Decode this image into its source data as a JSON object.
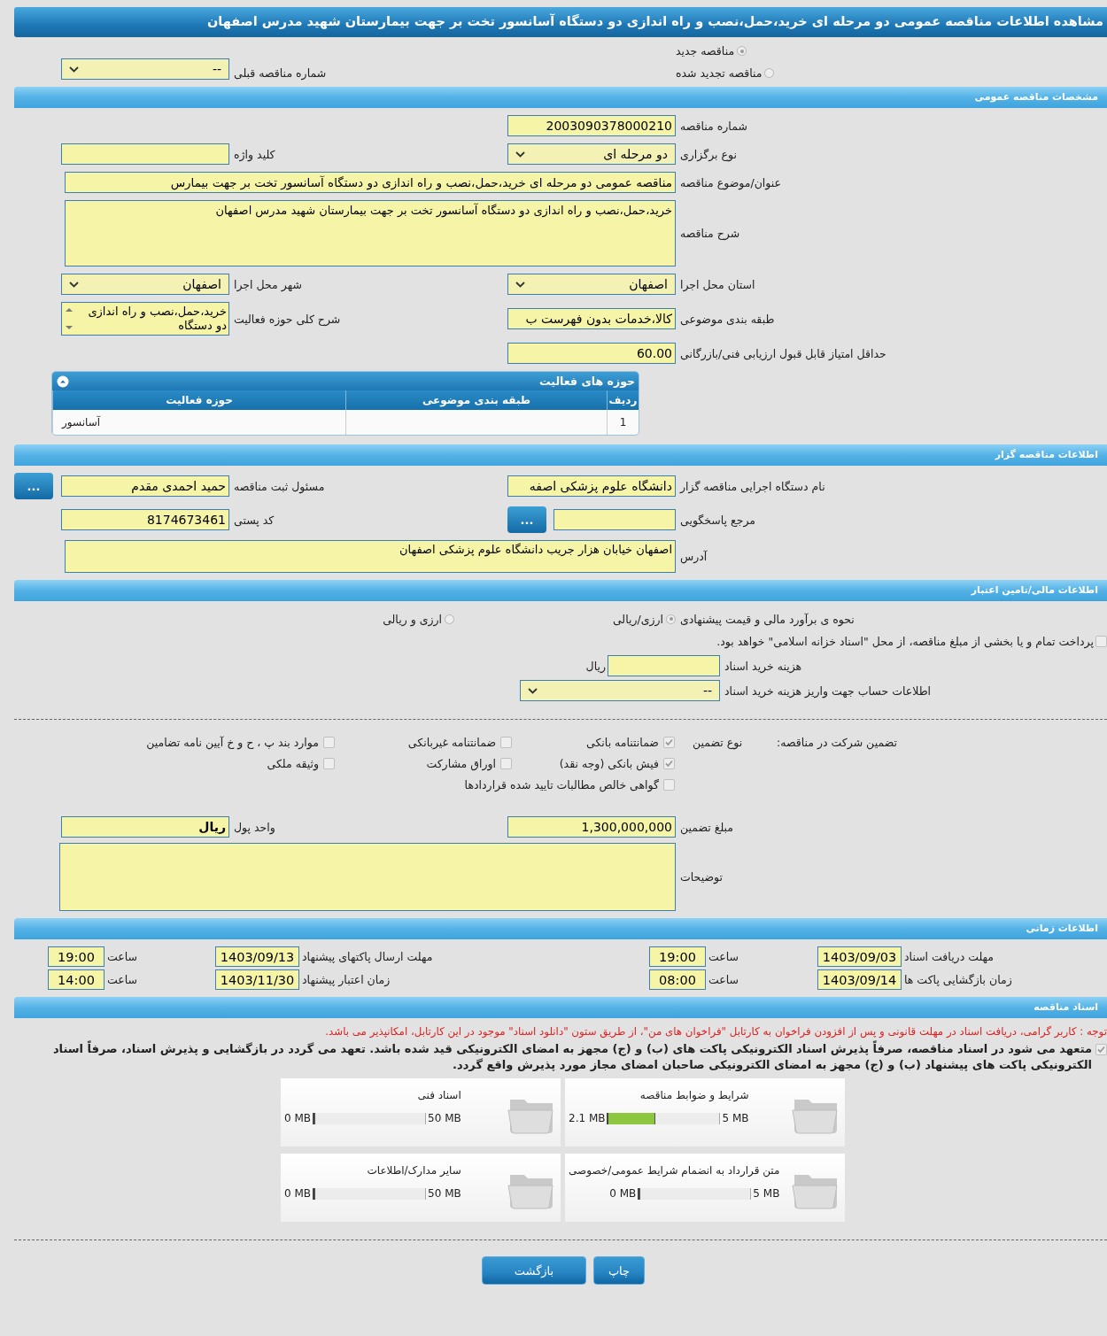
{
  "title": "مشاهده اطلاعات مناقصه عمومی دو مرحله ای خرید،حمل،نصب و راه اندازی دو دستگاه آسانسور تخت بر جهت بیمارستان شهید مدرس اصفهان",
  "tender_status": {
    "options": [
      {
        "label": "مناقصه جدید",
        "selected": true
      },
      {
        "label": "مناقصه تجدید شده",
        "selected": false
      }
    ],
    "previous_number": {
      "label": "شماره مناقصه قبلی",
      "kind": "select",
      "value": "--"
    }
  },
  "general": {
    "heading": "مشخصات مناقصه عمومی",
    "rows": [
      [
        {
          "label": "شماره مناقصه",
          "kind": "text",
          "value": "2003090378000210"
        }
      ],
      [
        {
          "label": "نوع برگزاری",
          "kind": "select",
          "value": "دو مرحله ای"
        },
        {
          "label": "کلید واژه",
          "kind": "text"
        }
      ],
      [
        {
          "label": "عنوان/موضوع مناقصه",
          "kind": "long_text",
          "value": "مناقصه عمومی دو مرحله ای  خرید،حمل،نصب و راه اندازی دو دستگاه آسانسور تخت بر جهت بیمارس"
        }
      ],
      [
        {
          "label": "شرح مناقصه",
          "kind": "textarea",
          "value": "خرید،حمل،نصب و راه اندازی دو دستگاه آسانسور تخت بر جهت بیمارستان شهید مدرس اصفهان"
        }
      ],
      [
        {
          "label": "استان محل اجرا",
          "kind": "select",
          "value": "اصفهان"
        },
        {
          "label": "شهر محل اجرا",
          "kind": "select",
          "value": "اصفهان"
        }
      ],
      [
        {
          "label": "طبقه بندی موضوعی",
          "kind": "text",
          "value": "کالا،خدمات بدون فهرست ب"
        },
        {
          "label": "شرح کلی حوزه فعالیت",
          "kind": "listbox",
          "value": "خرید،حمل،نصب و راه اندازی دو دستگاه"
        }
      ],
      [
        {
          "label": "حداقل امتیاز قابل قبول ارزیابی فنی/بازرگانی",
          "kind": "text",
          "value": "60.00"
        }
      ]
    ],
    "activities": {
      "title": "حوزه های فعالیت",
      "columns": [
        "ردیف",
        "طبقه بندی موضوعی",
        "حوزه فعالیت"
      ],
      "rows": [
        {
          "row_number": "1",
          "activity": "آسانسور"
        }
      ]
    }
  },
  "contractor": {
    "heading": "اطلاعات مناقصه گزار",
    "rows": [
      [
        {
          "label": "نام دستگاه اجرایی مناقصه گزار",
          "kind": "text",
          "value": "دانشگاه علوم پزشکی اصفه"
        },
        {
          "label": "مسئول ثبت مناقصه",
          "kind": "text",
          "value": "حمید احمدی مقدم",
          "button": "..."
        }
      ],
      [
        {
          "label": "مرجع پاسخگویی",
          "kind": "text",
          "button": "..."
        },
        {
          "label": "کد پستی",
          "kind": "text",
          "value": "8174673461"
        }
      ],
      [
        {
          "label": "آدرس",
          "kind": "memo",
          "value": "اصفهان خیابان هزار جریب دانشگاه علوم پزشکی اصفهان"
        }
      ]
    ]
  },
  "finance": {
    "heading": "اطلاعات مالی/تامین اعتبار",
    "estimate": {
      "label": "نحوه ی برآورد مالی و قیمت پیشنهادی",
      "options": [
        {
          "label": "ارزی/ریالی",
          "selected": true
        },
        {
          "label": "ارزی و ریالی",
          "selected": false
        }
      ]
    },
    "treasury": {
      "label": "پرداخت تمام و یا بخشی از مبلغ مناقصه، از محل \"اسناد خزانه اسلامی\" خواهد بود.",
      "checked": false
    },
    "document_fee": {
      "label": "هزینه خرید اسناد",
      "unit": "ریال"
    },
    "account": {
      "label": "اطلاعات حساب جهت واریز هزینه خرید اسناد",
      "value": "--"
    }
  },
  "guarantee": {
    "label": "تضمین شرکت در مناقصه:",
    "type_label": "نوع تضمین",
    "types": [
      {
        "label": "ضمانتنامه بانکی",
        "checked": true
      },
      {
        "label": "ضمانتنامه غیربانکی",
        "checked": false
      },
      {
        "label": "موارد بند پ ، ح و خ آیین نامه تضامین",
        "checked": false
      },
      {
        "label": "فیش بانکی (وجه نقد)",
        "checked": true
      },
      {
        "label": "اوراق مشارکت",
        "checked": false
      },
      {
        "label": "وثیقه ملکی",
        "checked": false
      },
      {
        "label": "گواهی خالص مطالبات تایید شده قراردادها",
        "checked": false
      }
    ],
    "amount": {
      "label": "مبلغ تضمین",
      "value": "1,300,000,000"
    },
    "currency": {
      "label": "واحد پول",
      "value": "ریال"
    },
    "notes": {
      "label": "توضیحات"
    }
  },
  "schedule": {
    "heading": "اطلاعات زمانی",
    "rows": [
      [
        {
          "label": "مهلت دریافت اسناد",
          "date": "1403/09/03",
          "time_label": "ساعت",
          "time": "19:00"
        },
        {
          "label": "مهلت ارسال پاکتهای پیشنهاد",
          "date": "1403/09/13",
          "time_label": "ساعت",
          "time": "19:00"
        }
      ],
      [
        {
          "label": "زمان بازگشایی پاکت ها",
          "date": "1403/09/14",
          "time_label": "ساعت",
          "time": "08:00"
        },
        {
          "label": "زمان اعتبار پیشنهاد",
          "date": "1403/11/30",
          "time_label": "ساعت",
          "time": "14:00"
        }
      ]
    ]
  },
  "documents": {
    "heading": "اسناد مناقصه",
    "notice": "توجه : کاربر گرامی، دریافت اسناد در مهلت قانونی و پس از افزودن فراخوان به کارتابل \"فراخوان های من\"، از طریق ستون \"دانلود اسناد\" موجود در این کارتابل، امکانپذیر می باشد.",
    "commitment": {
      "text": "متعهد می شود در اسناد مناقصه، صرفاً پذیرش اسناد الکترونیکی پاکت های (ب) و (ج) مجهز به امضای الکترونیکی قید شده باشد. تعهد می گردد در بازگشایی و پذیرش اسناد، صرفاً اسناد الکترونیکی پاکت های پیشنهاد (ب) و (ج) مجهز به امضای الکترونیکی صاحبان امضای مجاز مورد پذیرش واقع گردد.",
      "checked": true
    },
    "files": [
      {
        "title": "شرایط و ضوابط مناقصه",
        "used": "2.1 MB",
        "capacity": "5 MB",
        "level": 0.42
      },
      {
        "title": "اسناد فنی",
        "used": "0 MB",
        "capacity": "50 MB",
        "level": 0
      },
      {
        "title": "متن قرارداد به انضمام شرایط عمومی/خصوصی",
        "used": "0 MB",
        "capacity": "5 MB",
        "level": 0
      },
      {
        "title": "سایر مدارک/اطلاعات",
        "used": "0 MB",
        "capacity": "50 MB",
        "level": 0
      }
    ]
  },
  "buttons": [
    "چاپ",
    "بازگشت"
  ]
}
